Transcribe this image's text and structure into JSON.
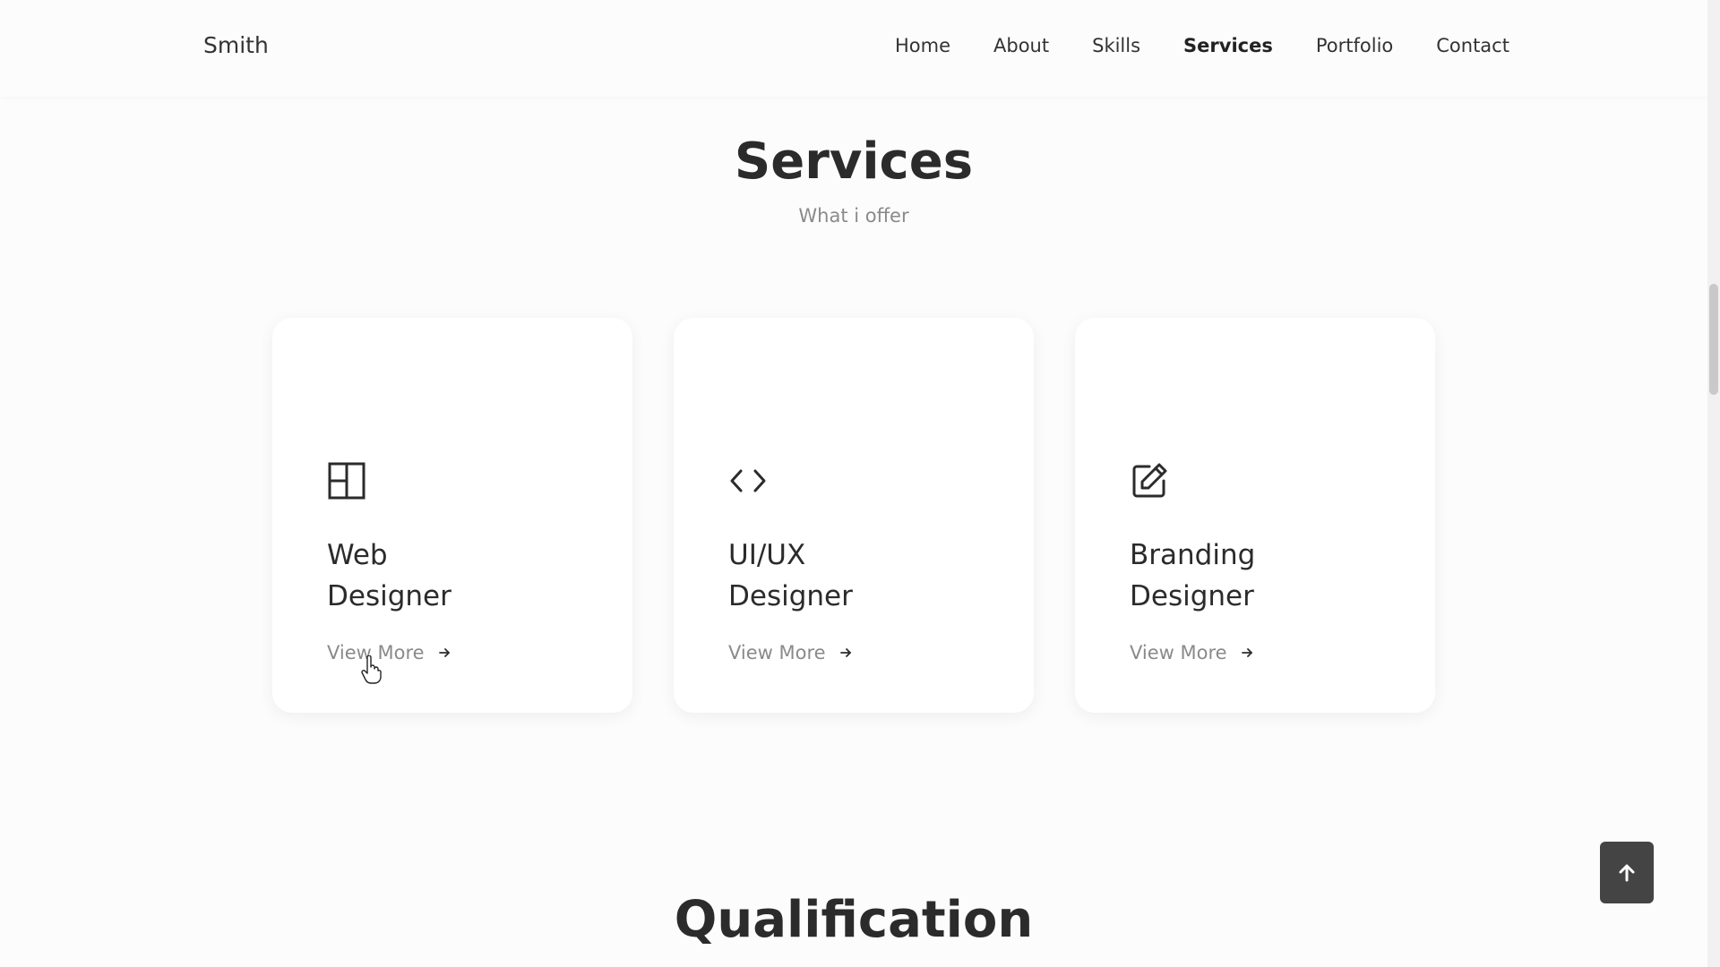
{
  "header": {
    "logo": "Smith",
    "nav": [
      "Home",
      "About",
      "Skills",
      "Services",
      "Portfolio",
      "Contact"
    ],
    "active": "Services"
  },
  "services": {
    "title": "Services",
    "subtitle": "What i offer",
    "cards": [
      {
        "title_line1": "Web",
        "title_line2": "Designer",
        "link": "View More",
        "icon": "layout-icon"
      },
      {
        "title_line1": "UI/UX",
        "title_line2": "Designer",
        "link": "View More",
        "icon": "code-icon"
      },
      {
        "title_line1": "Branding",
        "title_line2": "Designer",
        "link": "View More",
        "icon": "edit-icon"
      }
    ]
  },
  "qualification": {
    "title": "Qualification"
  },
  "scroll_progress": 0.2,
  "colors": {
    "accent": "#e2404a",
    "text": "#2b2b2b",
    "muted": "#8a8a8a",
    "button": "#444444"
  }
}
